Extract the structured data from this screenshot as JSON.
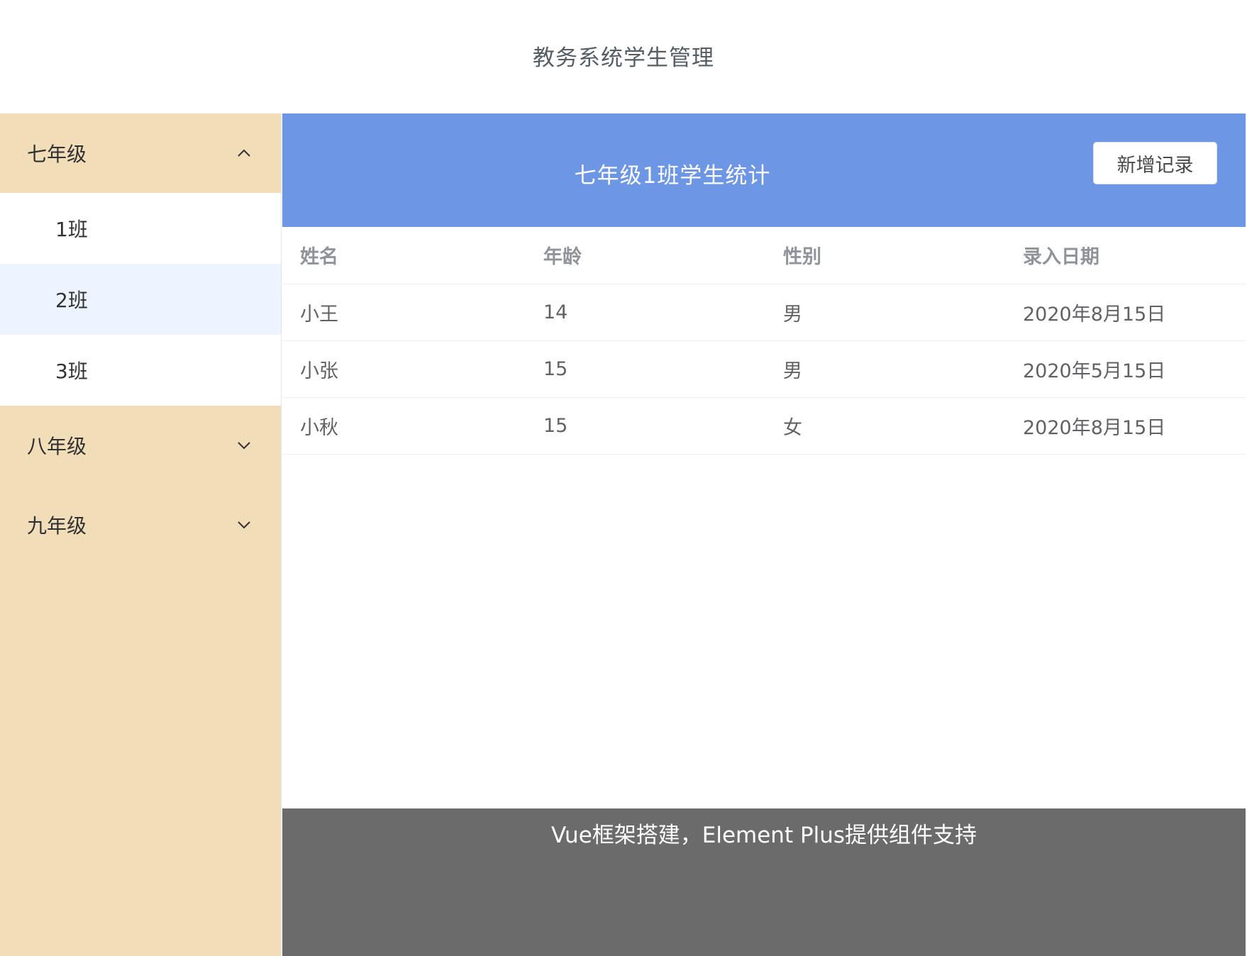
{
  "header": {
    "title": "教务系统学生管理"
  },
  "sidebar": {
    "grades": [
      {
        "label": "七年级",
        "expanded": true,
        "classes": [
          "1班",
          "2班",
          "3班"
        ],
        "active_class": "2班"
      },
      {
        "label": "八年级",
        "expanded": false
      },
      {
        "label": "九年级",
        "expanded": false
      }
    ]
  },
  "main": {
    "title": "七年级1班学生统计",
    "add_button": "新增记录",
    "table": {
      "columns": [
        "姓名",
        "年龄",
        "性别",
        "录入日期"
      ],
      "rows": [
        [
          "小王",
          "14",
          "男",
          "2020年8月15日"
        ],
        [
          "小张",
          "15",
          "男",
          "2020年5月15日"
        ],
        [
          "小秋",
          "15",
          "女",
          "2020年8月15日"
        ]
      ]
    }
  },
  "footer": {
    "text": "Vue框架搭建，Element Plus提供组件支持"
  },
  "colors": {
    "sidebar_bg": "#f2ddb9",
    "banner_bg": "#6d96e5",
    "active_item_bg": "#ecf5ff",
    "footer_bg": "#6b6b6b"
  },
  "icons": {
    "expanded": "chevron-up-icon",
    "collapsed": "chevron-down-icon"
  }
}
